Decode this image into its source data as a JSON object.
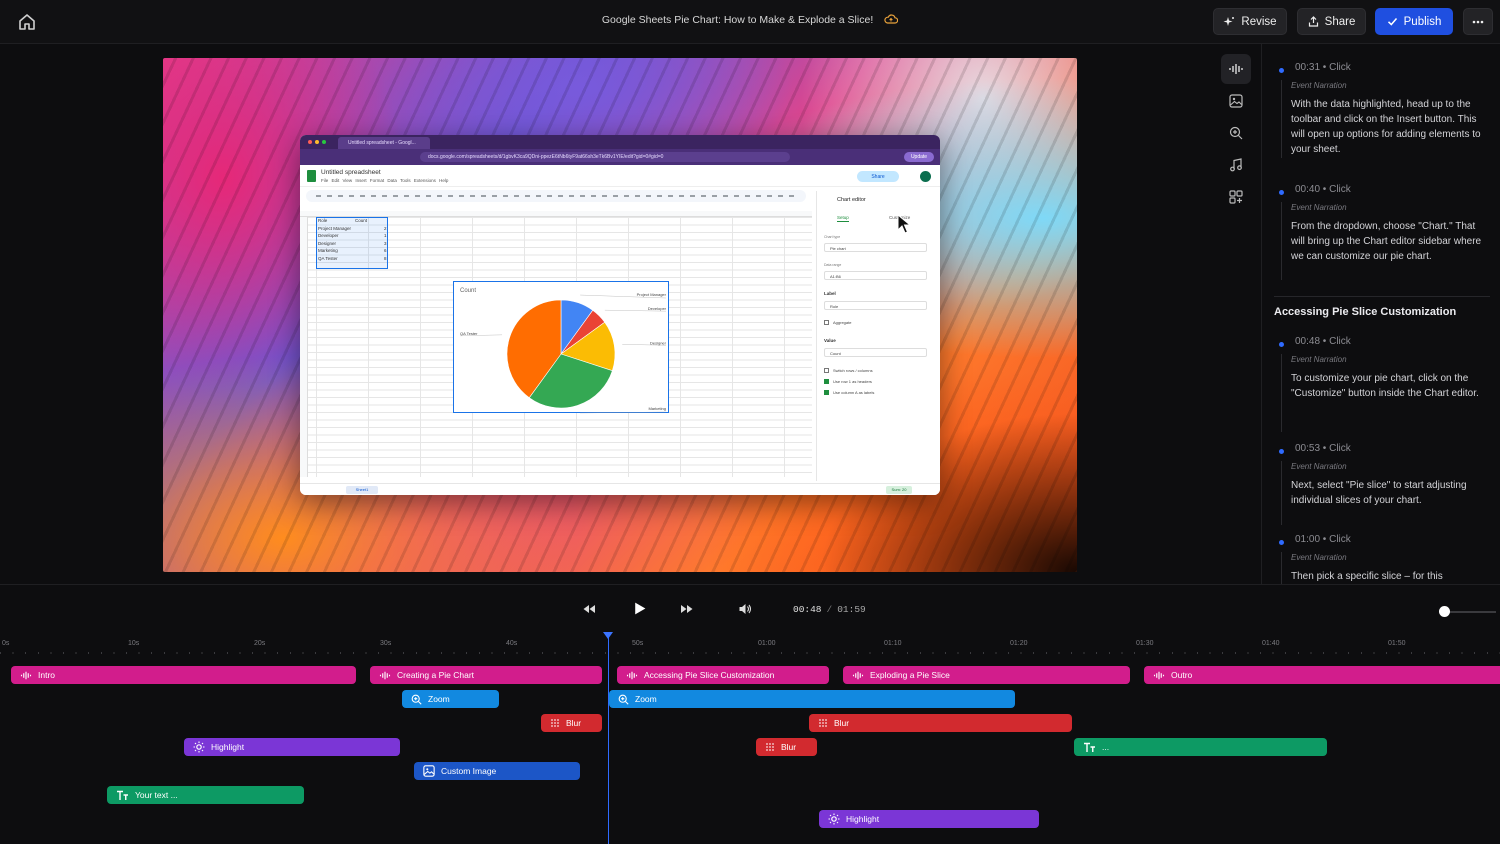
{
  "header": {
    "title": "Google Sheets Pie Chart: How to Make & Explode a Slice!",
    "revise_label": "Revise",
    "share_label": "Share",
    "publish_label": "Publish",
    "accent": "#1f4fe0"
  },
  "preview": {
    "browser": {
      "tab_title": "Untitled spreadsheet - Googl...",
      "url": "docs.google.com/spreadsheets/d/1gbvK3ca9QDni-ppezE6tNb6tyF9at66sh3eTk6Bv1YIE/edit?gid=0#gid=0",
      "update_label": "Update"
    },
    "sheet": {
      "name": "Untitled spreadsheet",
      "menu": "File  Edit  View  Insert  Format  Data  Tools  Extensions  Help",
      "share_label": "Share",
      "cells": [
        {
          "a": "Role",
          "b": "Count"
        },
        {
          "a": "Project Manager",
          "b": "2"
        },
        {
          "a": "Developer",
          "b": "1"
        },
        {
          "a": "Designer",
          "b": "3"
        },
        {
          "a": "Marketing",
          "b": "6"
        },
        {
          "a": "QA Tester",
          "b": "8"
        }
      ],
      "chart_title": "Count",
      "sheet_tab": "Sheet1",
      "sum_label": "Sum: 20"
    },
    "chart_data": {
      "type": "pie",
      "title": "Count",
      "categories": [
        "Project Manager",
        "Developer",
        "Designer",
        "Marketing",
        "QA Tester"
      ],
      "values": [
        2,
        1,
        3,
        6,
        8
      ],
      "colors": [
        "#4285f4",
        "#ea4335",
        "#fbbc04",
        "#34a853",
        "#ff6d01"
      ]
    },
    "editor": {
      "title": "Chart editor",
      "tab_setup": "Setup",
      "tab_customize": "Customize",
      "chart_type_label": "Chart type",
      "chart_type": "Pie chart",
      "data_range_label": "Data range",
      "data_range": "A1:B6",
      "label_section": "Label",
      "label_value": "Role",
      "aggregate": "Aggregate",
      "value_section": "Value",
      "value_value": "Count",
      "opt1": "Switch rows / columns",
      "opt2": "Use row 1 as headers",
      "opt3": "Use column A as labels"
    }
  },
  "events": [
    {
      "time": "00:31",
      "action": "Click",
      "kind": "Event Narration",
      "text": "With the data highlighted, head up to the toolbar and click on the Insert button. This will open up options for adding elements to your sheet."
    },
    {
      "time": "00:40",
      "action": "Click",
      "kind": "Event Narration",
      "text": "From the dropdown, choose \"Chart.\" That will bring up the Chart editor sidebar where we can customize our pie chart."
    },
    {
      "time": "00:48",
      "action": "Click",
      "kind": "Event Narration",
      "text": "To customize your pie chart, click on the \"Customize\" button inside the Chart editor."
    },
    {
      "time": "00:53",
      "action": "Click",
      "kind": "Event Narration",
      "text": "Next, select \"Pie slice\" to start adjusting individual slices of your chart."
    },
    {
      "time": "01:00",
      "action": "Click",
      "kind": "Event Narration",
      "text": "Then pick a specific slice – for this"
    }
  ],
  "section_title": "Accessing Pie Slice Customization",
  "transport": {
    "current": "00:48",
    "separator": "/",
    "duration": "01:59"
  },
  "ruler": [
    "0s",
    "10s",
    "20s",
    "30s",
    "40s",
    "50s",
    "01:00",
    "01:10",
    "01:20",
    "01:30",
    "01:40",
    "01:50"
  ],
  "clips": {
    "intro": "Intro",
    "creating": "Creating a Pie Chart",
    "accessing": "Accessing Pie Slice Customization",
    "exploding": "Exploding a Pie Slice",
    "outro": "Outro",
    "zoom1": "Zoom",
    "zoom2": "Zoom",
    "blur1": "Blur",
    "blur2": "Blur",
    "blur3": "Blur",
    "highlight1": "Highlight",
    "highlight2": "Highlight",
    "custom_image": "Custom Image",
    "text1": "Your text ...",
    "text2": "..."
  }
}
